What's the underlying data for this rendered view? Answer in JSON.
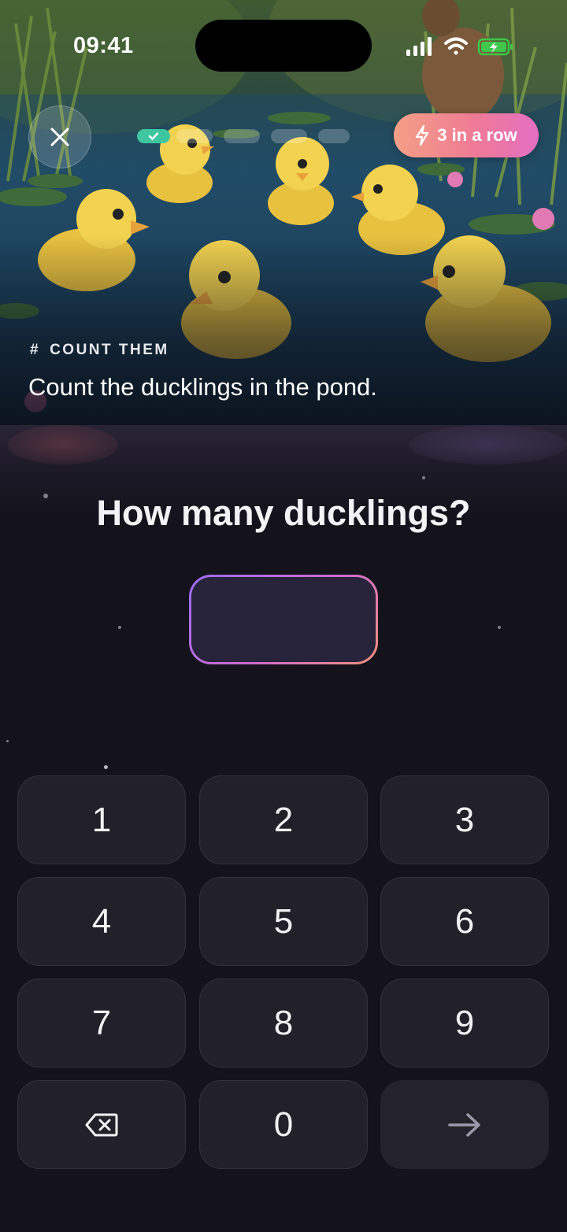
{
  "status_bar": {
    "time": "09:41"
  },
  "header": {
    "progress": {
      "total_steps": 5,
      "completed_steps": 1
    },
    "streak_label": "3 in a row",
    "icons": {
      "close": "close-icon",
      "streak": "lightning-bolt-icon",
      "done": "checkmark-icon"
    }
  },
  "hero": {
    "tag_symbol": "#",
    "tag": "COUNT THEM",
    "caption": "Count the ducklings in the pond."
  },
  "question": {
    "title": "How many ducklings?",
    "answer_value": ""
  },
  "keypad": {
    "keys": [
      "1",
      "2",
      "3",
      "4",
      "5",
      "6",
      "7",
      "8",
      "9"
    ],
    "zero": "0",
    "backspace_icon": "backspace-icon",
    "submit_icon": "arrow-right-icon"
  },
  "colors": {
    "background": "#14131b",
    "key_bg": "#222129",
    "progress_done": "#3ec79e",
    "streak_gradient": [
      "#f4a085",
      "#e46fc2"
    ],
    "answer_border_gradient": [
      "#9a6cf2",
      "#f2917a"
    ]
  }
}
